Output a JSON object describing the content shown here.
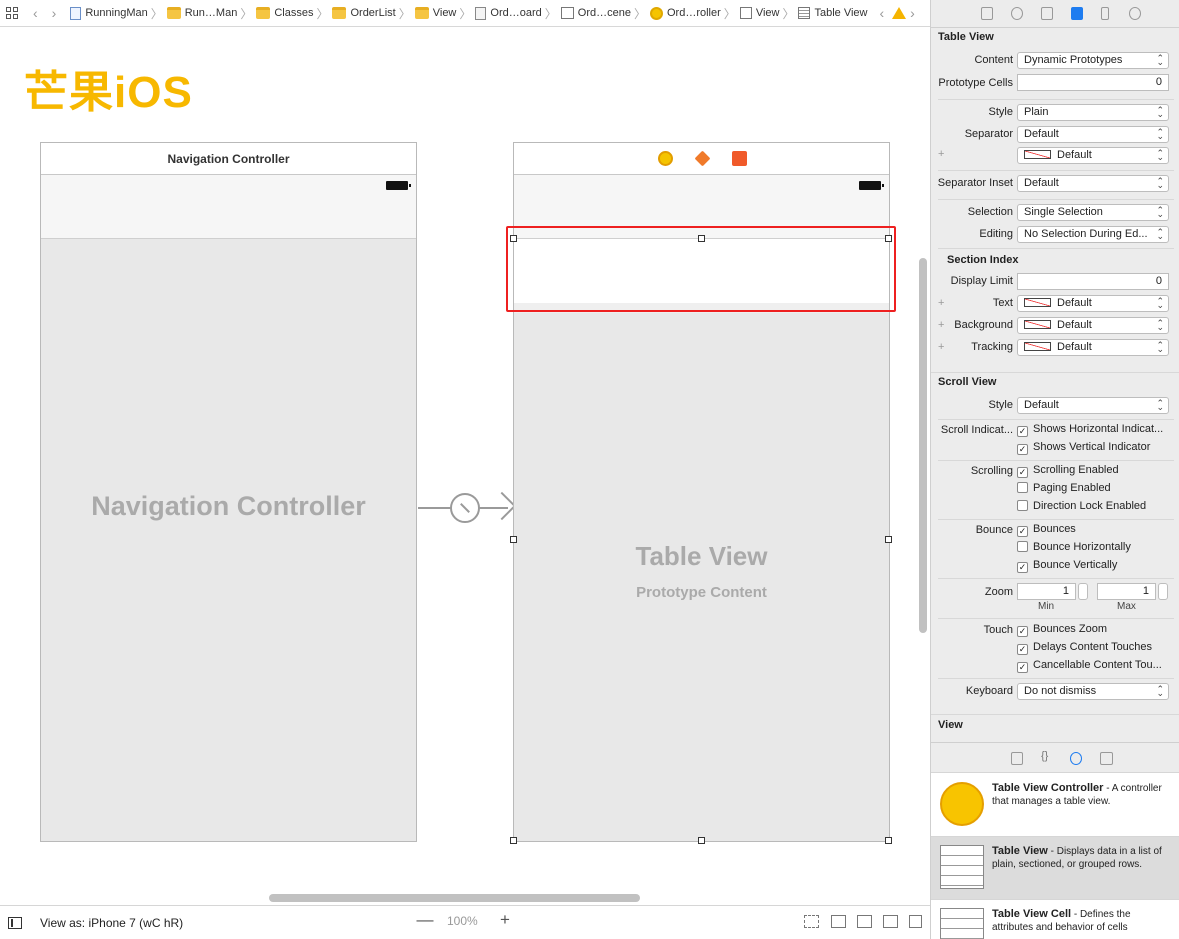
{
  "breadcrumb": {
    "items": [
      {
        "label": "RunningMan",
        "icon": "project-file-icon"
      },
      {
        "label": "Run…Man",
        "icon": "folder-icon"
      },
      {
        "label": "Classes",
        "icon": "folder-icon"
      },
      {
        "label": "OrderList",
        "icon": "folder-icon"
      },
      {
        "label": "View",
        "icon": "folder-icon"
      },
      {
        "label": "Ord…oard",
        "icon": "storyboard-icon"
      },
      {
        "label": "Ord…cene",
        "icon": "scene-icon"
      },
      {
        "label": "Ord…roller",
        "icon": "controller-icon"
      },
      {
        "label": "View",
        "icon": "view-icon"
      },
      {
        "label": "Table View",
        "icon": "table-view-icon"
      }
    ]
  },
  "watermark": "芒果iOS",
  "canvas": {
    "nav_scene_title": "Navigation Controller",
    "nav_big_label": "Navigation Controller",
    "table_big_label": "Table View",
    "table_sub_label": "Prototype Content"
  },
  "bottombar": {
    "view_as": "View as: iPhone 7 (wC hR)",
    "zoom_minus": "—",
    "zoom_value": "100%",
    "zoom_plus": "+"
  },
  "inspector": {
    "table_view_title": "Table View",
    "content_label": "Content",
    "content_value": "Dynamic Prototypes",
    "proto_cells_label": "Prototype Cells",
    "proto_cells_value": "0",
    "style_label": "Style",
    "style_value": "Plain",
    "separator_label": "Separator",
    "separator_value": "Default",
    "separator_color_value": "Default",
    "separator_inset_label": "Separator Inset",
    "separator_inset_value": "Default",
    "selection_label": "Selection",
    "selection_value": "Single Selection",
    "editing_label": "Editing",
    "editing_value": "No Selection During Ed...",
    "section_index_title": "Section Index",
    "display_limit_label": "Display Limit",
    "display_limit_value": "0",
    "text_label": "Text",
    "text_value": "Default",
    "background_label": "Background",
    "background_value": "Default",
    "tracking_label": "Tracking",
    "tracking_value": "Default",
    "scroll_view_title": "Scroll View",
    "sv_style_label": "Style",
    "sv_style_value": "Default",
    "scroll_indicators_label": "Scroll Indicat...",
    "shows_horizontal": "Shows Horizontal Indicat...",
    "shows_vertical": "Shows Vertical Indicator",
    "scrolling_label": "Scrolling",
    "scrolling_enabled": "Scrolling Enabled",
    "paging_enabled": "Paging Enabled",
    "direction_lock": "Direction Lock Enabled",
    "bounce_label": "Bounce",
    "bounces": "Bounces",
    "bounce_horizontally": "Bounce Horizontally",
    "bounce_vertically": "Bounce Vertically",
    "zoom_label": "Zoom",
    "zoom_min_value": "1",
    "zoom_max_value": "1",
    "min_label": "Min",
    "max_label": "Max",
    "touch_label": "Touch",
    "bounces_zoom": "Bounces Zoom",
    "delays_content": "Delays Content Touches",
    "cancellable_content": "Cancellable Content Tou...",
    "keyboard_label": "Keyboard",
    "keyboard_value": "Do not dismiss",
    "view_title": "View",
    "checkbox_states": {
      "shows_horizontal": true,
      "shows_vertical": true,
      "scrolling_enabled": true,
      "paging_enabled": false,
      "direction_lock": false,
      "bounces": true,
      "bounce_horizontally": false,
      "bounce_vertically": true,
      "bounces_zoom": true,
      "delays_content": true,
      "cancellable_content": true
    }
  },
  "library": {
    "items": [
      {
        "name": "Table View Controller",
        "desc": " - A controller that manages a table view."
      },
      {
        "name": "Table View",
        "desc": " - Displays data in a list of plain, sectioned, or grouped rows."
      },
      {
        "name": "Table View Cell",
        "desc": " - Defines the attributes and behavior of cells"
      }
    ]
  },
  "colors": {
    "watermark": "#f7b800",
    "highlight": "#ee2020",
    "selected_tab": "#1e7cf0"
  }
}
